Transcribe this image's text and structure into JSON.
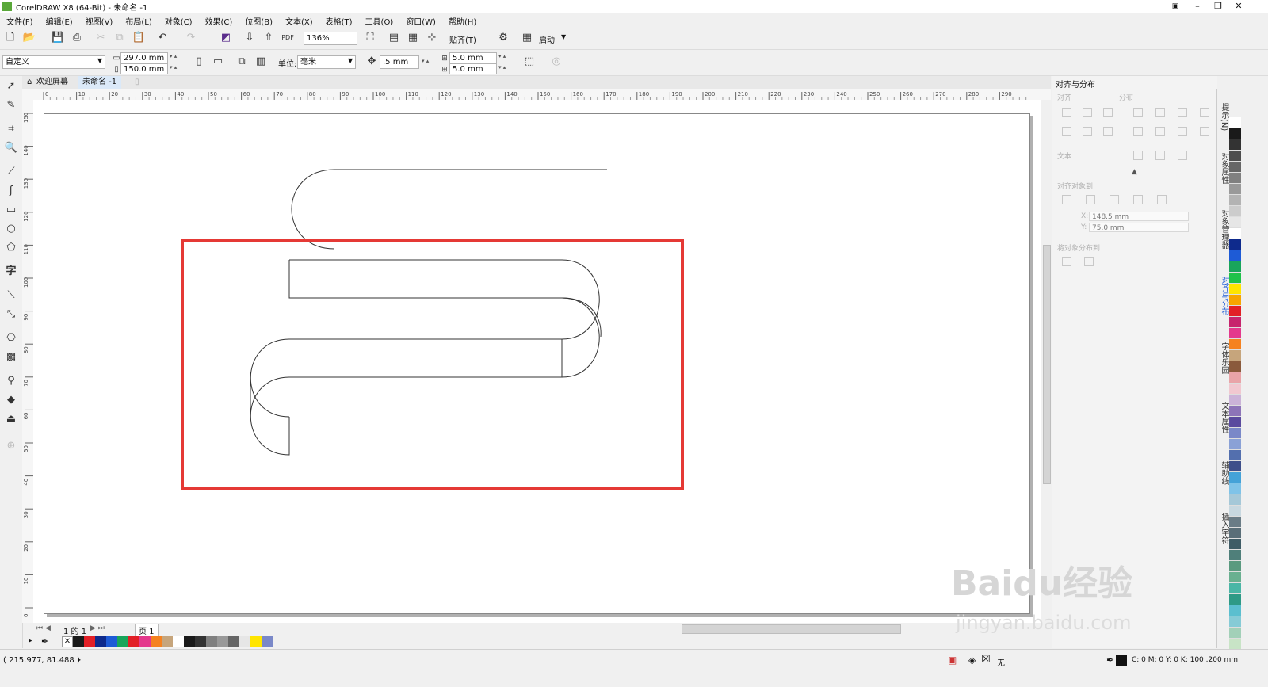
{
  "window": {
    "title": "CorelDRAW X8 (64-Bit) - 未命名 -1",
    "minimize": "–",
    "restore": "❐",
    "close": "✕"
  },
  "menubar": [
    "文件(F)",
    "编辑(E)",
    "视图(V)",
    "布局(L)",
    "对象(C)",
    "效果(C)",
    "位图(B)",
    "文本(X)",
    "表格(T)",
    "工具(O)",
    "窗口(W)",
    "帮助(H)"
  ],
  "toolbar": {
    "zoom": "136%",
    "snap_label": "贴齐(T)",
    "launch_label": "启动",
    "pdf_label": "PDF"
  },
  "propertybar": {
    "preset": "自定义",
    "page_width": "297.0 mm",
    "page_height": "150.0 mm",
    "unit_label": "单位:",
    "unit_value": "毫米",
    "nudge": ".5 mm",
    "dup_x": "5.0 mm",
    "dup_y": "5.0 mm"
  },
  "tabs": {
    "welcome": "欢迎屏幕",
    "document": "未命名 -1"
  },
  "ruler_h": [
    "0",
    "10",
    "20",
    "30",
    "40",
    "50",
    "60",
    "70",
    "80",
    "90",
    "100",
    "110",
    "120",
    "130",
    "140",
    "150",
    "160",
    "170",
    "180",
    "190",
    "200",
    "210",
    "220",
    "230",
    "240",
    "250",
    "260",
    "270",
    "280",
    "290"
  ],
  "ruler_v": [
    "150",
    "140",
    "130",
    "120",
    "110",
    "100",
    "90",
    "80",
    "70",
    "60",
    "50",
    "40",
    "30",
    "20",
    "10",
    "0"
  ],
  "ruler_unit": "毫米",
  "docker": {
    "title": "对齐与分布",
    "align_label": "对齐",
    "distribute_label": "分布",
    "text_label": "文本",
    "align_objects_to": "对齐对象到",
    "x_value": "148.5 mm",
    "y_value": "75.0 mm",
    "x_label": "X:",
    "y_label": "Y:",
    "distribute_objects_to": "将对象分布到"
  },
  "side_tabs": [
    "提示(N)",
    "对象属性",
    "对象管理器",
    "对齐与分布",
    "字体乐园",
    "文本属性",
    "辅助线",
    "插入字符"
  ],
  "page_nav": {
    "position": "1 的 1",
    "page_tab": "页 1"
  },
  "status": {
    "coords": "( 215.977, 81.488 )",
    "fill_none": "无",
    "outline_info": "C: 0 M: 0 Y: 0 K: 100  .200 mm"
  },
  "colors": {
    "highlight_box": "#e53935",
    "right_palette": [
      "#ffffff",
      "#1a1a1a",
      "#333333",
      "#4d4d4d",
      "#666666",
      "#808080",
      "#999999",
      "#b3b3b3",
      "#cccccc",
      "#e6e6e6",
      "#ffffff",
      "#0e2a8c",
      "#1e5bd6",
      "#19a55b",
      "#1fc24a",
      "#ffe500",
      "#f7a400",
      "#e21f26",
      "#c7246d",
      "#e4398d",
      "#f58220",
      "#c6a57c",
      "#8a5a3c",
      "#e9a4a8",
      "#f1c8d0",
      "#cbb3d8",
      "#8d74b8",
      "#5a4a9e",
      "#7a88c8",
      "#8aa1d6",
      "#536fae",
      "#3e4f8a",
      "#44a2d8",
      "#7fc3e8",
      "#a5c8d8",
      "#c8d8e0",
      "#6a7c86",
      "#5a6e78",
      "#3f5c66",
      "#4f7f7a",
      "#5a9a7f",
      "#69b090",
      "#4ab6a6",
      "#2e9a86",
      "#5bbfcf",
      "#86cbd6",
      "#a2d0b8",
      "#c8e4c6",
      "#e8f1e4"
    ],
    "bottom_palette": [
      "#1a1a1a",
      "#e21f26",
      "#0e2a8c",
      "#1e5bd6",
      "#19a55b",
      "#e21f26",
      "#e4398d",
      "#f58220",
      "#c6a57c",
      "#ffffff",
      "#1a1a1a",
      "#333333",
      "#808080",
      "#999999",
      "#666666",
      "#e6e6e6",
      "#ffe500",
      "#7a88c8"
    ]
  },
  "watermark": {
    "main": "Baidu经验",
    "sub": "jingyan.baidu.com"
  }
}
